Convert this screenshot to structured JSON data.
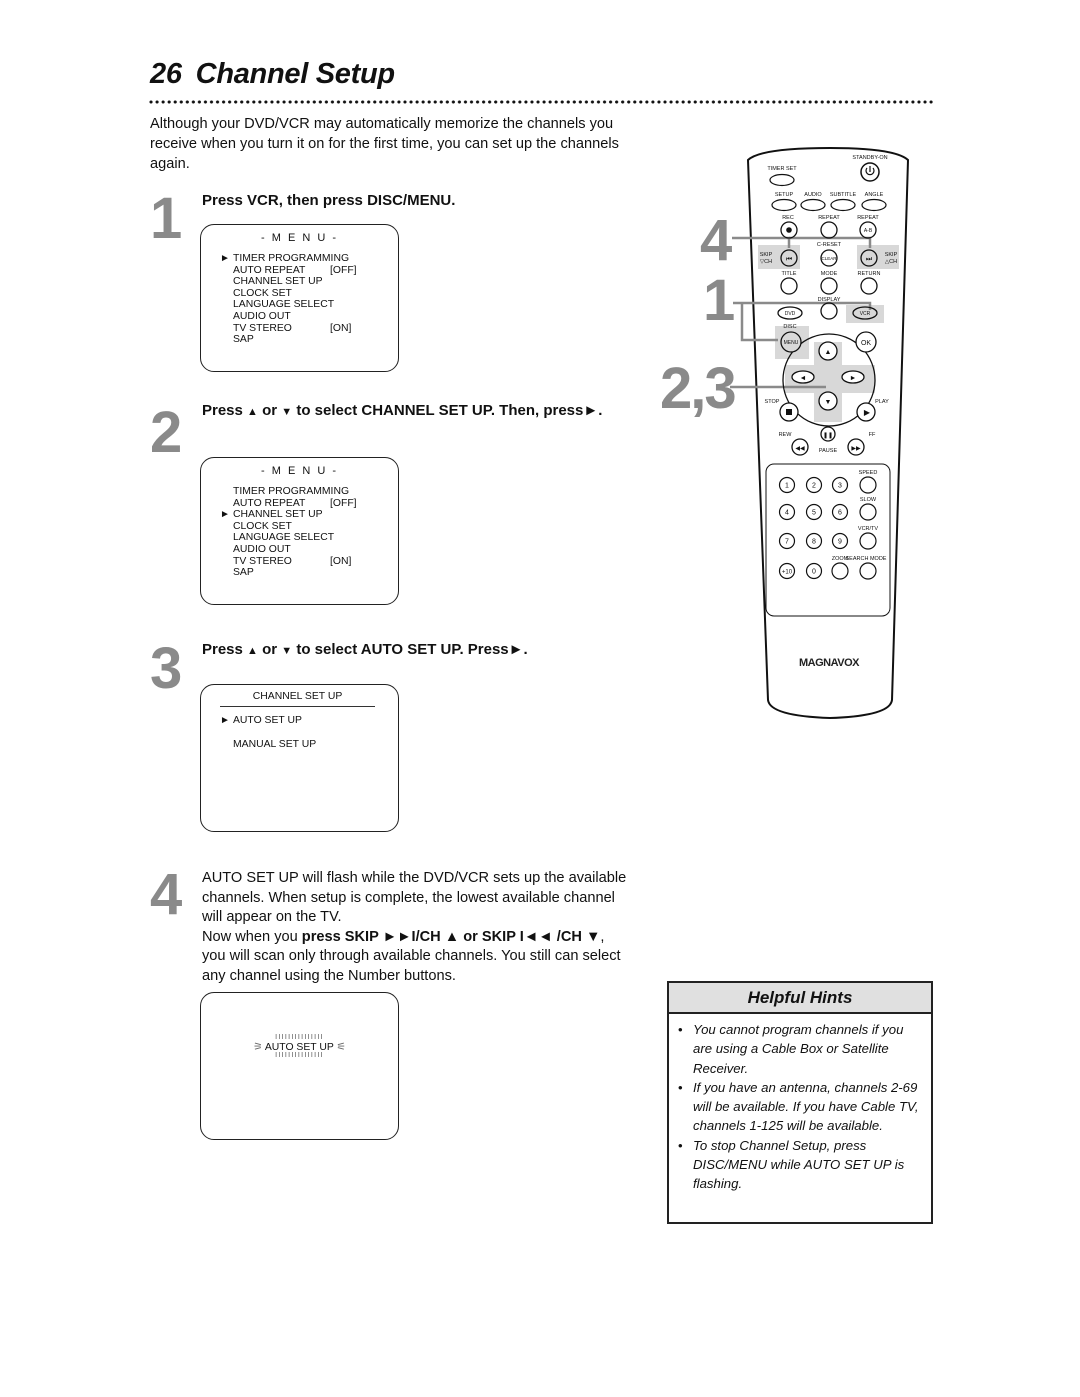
{
  "page": {
    "number": "26",
    "title": "Channel Setup",
    "intro": "Although your DVD/VCR may automatically memorize the channels you receive when you turn it on for the first time, you can set up the channels again."
  },
  "steps": [
    {
      "number": "1",
      "heading": "Press VCR, then press DISC/MENU.",
      "screen": {
        "title": "- M E N U -",
        "items": [
          {
            "label": "TIMER PROGRAMMING",
            "value": "",
            "selected": true
          },
          {
            "label": "AUTO REPEAT",
            "value": "[OFF]",
            "selected": false
          },
          {
            "label": "CHANNEL SET UP",
            "value": "",
            "selected": false
          },
          {
            "label": "CLOCK SET",
            "value": "",
            "selected": false
          },
          {
            "label": "LANGUAGE SELECT",
            "value": "",
            "selected": false
          },
          {
            "label": "AUDIO OUT",
            "value": "",
            "selected": false
          },
          {
            "label": "TV STEREO",
            "value": "[ON]",
            "selected": false
          },
          {
            "label": "SAP",
            "value": "",
            "selected": false
          }
        ]
      }
    },
    {
      "number": "2",
      "heading_parts": [
        "Press",
        "▲",
        "or",
        "▼",
        "to select CHANNEL SET UP. Then, press",
        "►",
        "."
      ],
      "screen": {
        "title": "- M E N U -",
        "items": [
          {
            "label": "TIMER PROGRAMMING",
            "value": "",
            "selected": false
          },
          {
            "label": "AUTO REPEAT",
            "value": "[OFF]",
            "selected": false
          },
          {
            "label": "CHANNEL SET UP",
            "value": "",
            "selected": true
          },
          {
            "label": "CLOCK SET",
            "value": "",
            "selected": false
          },
          {
            "label": "LANGUAGE SELECT",
            "value": "",
            "selected": false
          },
          {
            "label": "AUDIO OUT",
            "value": "",
            "selected": false
          },
          {
            "label": "TV STEREO",
            "value": "[ON]",
            "selected": false
          },
          {
            "label": "SAP",
            "value": "",
            "selected": false
          }
        ]
      }
    },
    {
      "number": "3",
      "heading_parts": [
        "Press",
        "▲",
        "or",
        "▼",
        "to select AUTO SET UP. Press",
        "►",
        "."
      ],
      "screen": {
        "title": "CHANNEL SET UP",
        "items": [
          {
            "label": "AUTO SET UP",
            "selected": true
          },
          {
            "label": "MANUAL SET UP",
            "selected": false
          }
        ]
      }
    },
    {
      "number": "4",
      "text": "AUTO SET UP will flash while the DVD/VCR sets up the available channels. When setup is complete, the lowest available channel will appear on the TV.",
      "text2_pre": "Now when you ",
      "text2_bold1": "press SKIP ►►I/CH ▲ or SKIP I◄◄",
      "text2_bold2": "/CH ▼",
      "text2_post": ", you will scan only through available channels. You still can select any channel using the Number buttons.",
      "screen": {
        "flash_text": "AUTO SET UP",
        "flash_marks": "IIIIIIIIIIIIIII"
      }
    }
  ],
  "hints": {
    "title": "Helpful Hints",
    "bullet": "•",
    "items": [
      "You cannot program channels if you are using a Cable Box or Satellite Receiver.",
      "If you have an antenna, channels 2-69 will be available. If you have Cable TV, channels 1-125 will be available.",
      "To stop Channel Setup, press DISC/MENU while AUTO SET UP is flashing."
    ]
  },
  "remote": {
    "brand": "MAGNAVOX",
    "callouts": [
      "4",
      "1",
      "2,3"
    ],
    "labels": {
      "standby": "STANDBY-ON",
      "timer_set": "TIMER SET",
      "setup": "SETUP",
      "audio": "AUDIO",
      "subtitle": "SUBTITLE",
      "angle": "ANGLE",
      "rec": "REC",
      "repeat": "REPEAT",
      "repeat_ab": "REPEAT",
      "ab": "A-B",
      "c_reset": "C-RESET",
      "clear": "CLEAR",
      "skip_left": "SKIP",
      "skip_left_ch": "▽CH",
      "skip_right": "SKIP",
      "skip_right_ch": "△CH",
      "title": "TITLE",
      "mode": "MODE",
      "return": "RETURN",
      "display": "DISPLAY",
      "dvd": "DVD",
      "vcr": "VCR",
      "disc": "DISC",
      "menu": "MENU",
      "ok": "OK",
      "stop": "STOP",
      "play": "PLAY",
      "rew": "REW",
      "ff": "FF",
      "pause": "PAUSE",
      "speed": "SPEED",
      "slow": "SLOW",
      "vcr_tv": "VCR/TV",
      "zoom": "ZOOM",
      "search_mode": "SEARCH MODE"
    },
    "numbers": [
      "1",
      "2",
      "3",
      "4",
      "5",
      "6",
      "7",
      "8",
      "9",
      "+10",
      "0"
    ],
    "highlight_color": "#d8d8d8",
    "callout_color": "#8a8a8a"
  }
}
